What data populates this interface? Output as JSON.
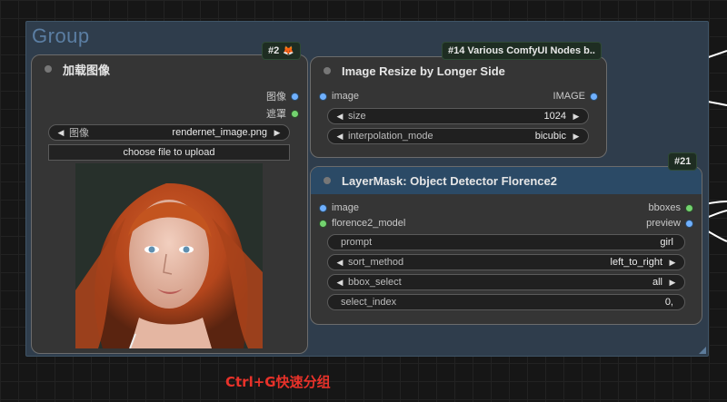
{
  "group": {
    "title": "Group"
  },
  "node_load_image": {
    "badge": "#2",
    "title": "加载图像",
    "outputs": [
      "图像",
      "遮罩"
    ],
    "image_widget": {
      "label": "图像",
      "value": "rendernet_image.png"
    },
    "upload_label": "choose file to upload",
    "preview_image": "portrait of red-haired woman"
  },
  "node_resize": {
    "badge": "#14 Various ComfyUI Nodes b..",
    "title": "Image Resize by Longer Side",
    "input": "image",
    "output": "IMAGE",
    "widgets": [
      {
        "label": "size",
        "value": "1024"
      },
      {
        "label": "interpolation_mode",
        "value": "bicubic"
      }
    ]
  },
  "node_florence": {
    "badge": "#21",
    "title": "LayerMask: Object Detector Florence2",
    "inputs": [
      "image",
      "florence2_model"
    ],
    "outputs": [
      "bboxes",
      "preview"
    ],
    "widgets": [
      {
        "label": "prompt",
        "value": "girl",
        "kind": "text"
      },
      {
        "label": "sort_method",
        "value": "left_to_right",
        "kind": "combo"
      },
      {
        "label": "bbox_select",
        "value": "all",
        "kind": "combo"
      },
      {
        "label": "select_index",
        "value": "0,",
        "kind": "text"
      }
    ]
  },
  "caption": "Ctrl+G快速分组",
  "colors": {
    "group_bg": "#2f3d4c",
    "group_title": "#5b7ea3",
    "florence_title_bg": "#2b4a66",
    "image_slot": "#6fb0ff",
    "mask_slot": "#73d36f",
    "caption": "#e8322a"
  }
}
